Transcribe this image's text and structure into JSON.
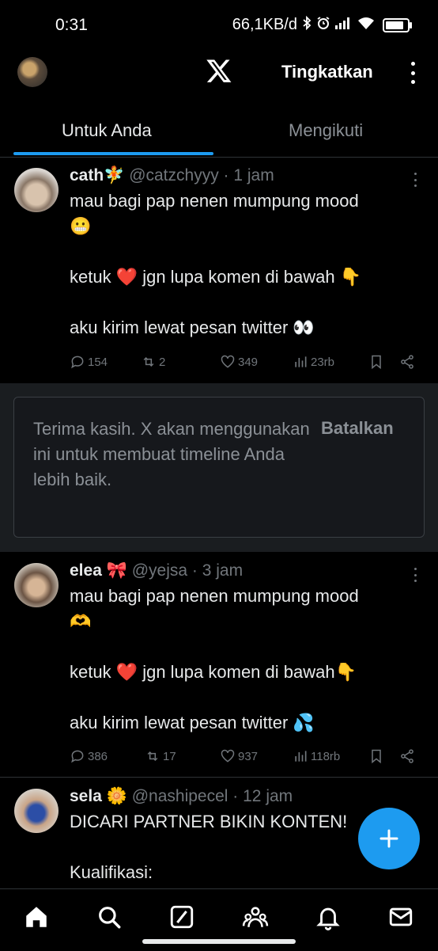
{
  "status_bar": {
    "time": "0:31",
    "network_speed": "66,1KB/d",
    "icons": [
      "bluetooth-icon",
      "alarm-icon",
      "signal-icon",
      "wifi-icon",
      "battery-icon"
    ],
    "battery_level": 0.85
  },
  "top_bar": {
    "logo": "x-logo-icon",
    "upgrade_label": "Tingkatkan"
  },
  "tabs": [
    {
      "label": "Untuk Anda",
      "active": true
    },
    {
      "label": "Mengikuti",
      "active": false
    }
  ],
  "posts": [
    {
      "name": "cath",
      "name_emoji": "🧚",
      "handle": "@catzchyyy",
      "time": "· 1 jam",
      "lines": [
        "mau bagi pap nenen mumpung mood",
        "😬",
        "",
        "ketuk ❤️ jgn lupa komen di bawah 👇",
        "",
        "aku kirim lewat pesan twitter 👀"
      ],
      "replies": "154",
      "reposts": "2",
      "likes": "349",
      "views": "23rb"
    },
    {
      "name": "elea",
      "name_emoji": "🎀",
      "handle": "@yejsa",
      "time": "· 3 jam",
      "lines": [
        "mau bagi pap nenen mumpung mood",
        "🫶",
        "",
        "ketuk ❤️ jgn lupa komen di bawah👇",
        "",
        "aku kirim lewat pesan twitter 💦"
      ],
      "replies": "386",
      "reposts": "17",
      "likes": "937",
      "views": "118rb"
    },
    {
      "name": "sela",
      "name_emoji": "🌼",
      "handle": "@nashipecel",
      "time": "· 12 jam",
      "lines": [
        "DICARI PARTNER BIKIN KONTEN!",
        "",
        "Kualifikasi:"
      ]
    }
  ],
  "feedback": {
    "message": "Terima kasih. X akan menggunakan ini untuk membuat timeline Anda lebih baik.",
    "cancel_label": "Batalkan"
  },
  "fab": {
    "icon": "plus-icon"
  },
  "bottom_nav": [
    "home-icon",
    "search-icon",
    "grok-icon",
    "communities-icon",
    "notifications-icon",
    "messages-icon"
  ],
  "colors": {
    "accent": "#1d9bf0",
    "background": "#000000",
    "muted": "#71767b",
    "like": "#f91880"
  }
}
